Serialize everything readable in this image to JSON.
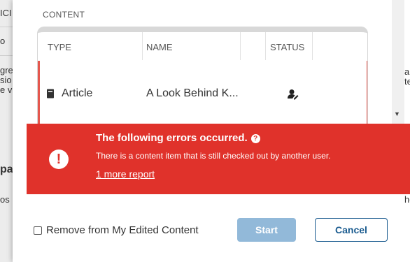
{
  "background": {
    "fragments": [
      "ICI",
      "o",
      "gre",
      "sio",
      "e v",
      "pa",
      "os",
      "a",
      "te",
      "he"
    ]
  },
  "dialog": {
    "section_label": "CONTENT",
    "table": {
      "headers": [
        "TYPE",
        "NAME",
        "STATUS"
      ],
      "rows": [
        {
          "type": "Article",
          "name": "A Look Behind K...",
          "status_icon": "checked-out-user-icon"
        }
      ]
    },
    "error": {
      "title": "The following errors occurred.",
      "help_icon": "?",
      "alert_icon": "!",
      "message": "There is a content item that is still checked out by another user.",
      "link": "1 more report"
    },
    "footer": {
      "checkbox_label": "Remove from My Edited Content",
      "start_label": "Start",
      "cancel_label": "Cancel"
    }
  },
  "colors": {
    "error_bg": "#e0322b",
    "primary": "#1a5b8f",
    "primary_disabled": "#92b9d9"
  }
}
